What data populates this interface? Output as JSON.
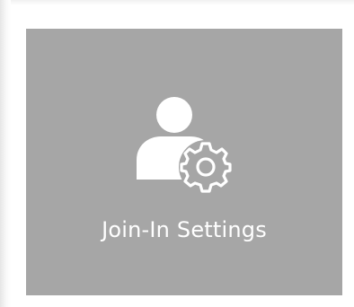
{
  "tile": {
    "label": "Join-In Settings",
    "icon": "user-settings-icon",
    "background_color": "#a6a6a6",
    "foreground_color": "#ffffff"
  }
}
